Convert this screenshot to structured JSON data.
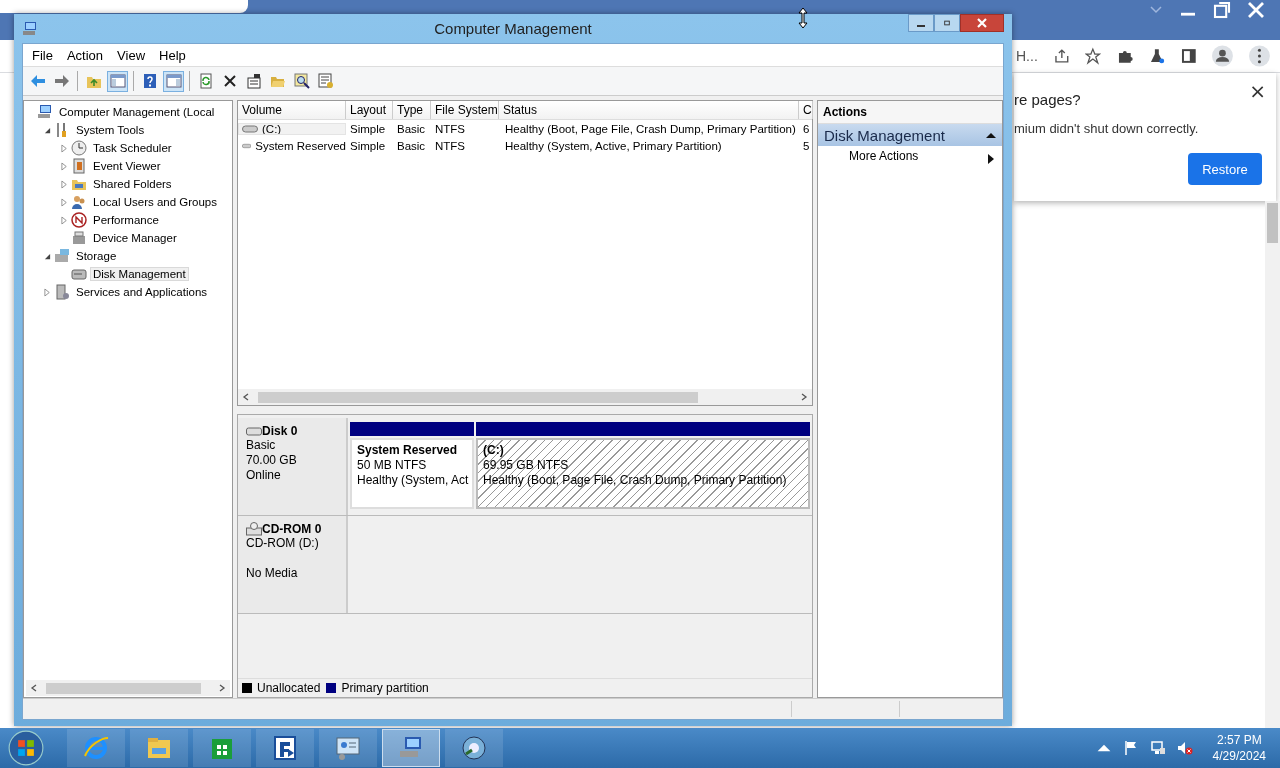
{
  "browser": {
    "address": "H...",
    "restore_dialog": {
      "title": "re pages?",
      "message": "mium didn't shut down correctly.",
      "button": "Restore",
      "close": "×"
    }
  },
  "window": {
    "title": "Computer Management"
  },
  "menu": [
    "File",
    "Action",
    "View",
    "Help"
  ],
  "toolbar": [
    {
      "kind": "back",
      "on": false
    },
    {
      "kind": "forward",
      "on": false
    },
    {
      "kind": "sep"
    },
    {
      "kind": "up",
      "on": false
    },
    {
      "kind": "tree",
      "on": true
    },
    {
      "kind": "sep"
    },
    {
      "kind": "help",
      "on": false
    },
    {
      "kind": "pane",
      "on": true
    },
    {
      "kind": "sep"
    },
    {
      "kind": "refresh",
      "on": false
    },
    {
      "kind": "delete",
      "on": false
    },
    {
      "kind": "properties",
      "on": false
    },
    {
      "kind": "open",
      "on": false
    },
    {
      "kind": "find",
      "on": false
    },
    {
      "kind": "settings",
      "on": false
    }
  ],
  "tree": [
    {
      "label": "Computer Management (Local",
      "kind": "computer",
      "selected": false,
      "children": [
        {
          "label": "System Tools",
          "kind": "tools",
          "expanded": true,
          "selected": false,
          "children": [
            {
              "label": "Task Scheduler",
              "kind": "clock",
              "expanded": false,
              "selected": false
            },
            {
              "label": "Event Viewer",
              "kind": "log",
              "expanded": false,
              "selected": false
            },
            {
              "label": "Shared Folders",
              "kind": "share",
              "expanded": false,
              "selected": false
            },
            {
              "label": "Local Users and Groups",
              "kind": "users",
              "expanded": false,
              "selected": false
            },
            {
              "label": "Performance",
              "kind": "gauge",
              "expanded": false,
              "selected": false
            },
            {
              "label": "Device Manager",
              "kind": "device",
              "selected": false
            }
          ]
        },
        {
          "label": "Storage",
          "kind": "storage",
          "expanded": true,
          "selected": false,
          "children": [
            {
              "label": "Disk Management",
              "kind": "disk",
              "selected": true
            }
          ]
        },
        {
          "label": "Services and Applications",
          "kind": "services",
          "expanded": false,
          "selected": false
        }
      ]
    }
  ],
  "volumes": {
    "columns": [
      "Volume",
      "Layout",
      "Type",
      "File System",
      "Status",
      "C"
    ],
    "rows": [
      {
        "selected": true,
        "cells": [
          "(C:)",
          "Simple",
          "Basic",
          "NTFS",
          "Healthy (Boot, Page File, Crash Dump, Primary Partition)",
          "6"
        ]
      },
      {
        "selected": false,
        "cells": [
          "System Reserved",
          "Simple",
          "Basic",
          "NTFS",
          "Healthy (System, Active, Primary Partition)",
          "5"
        ]
      }
    ]
  },
  "disks": [
    {
      "kind": "disk",
      "name": "Disk 0",
      "lines": [
        "Basic",
        "70.00 GB",
        "Online"
      ],
      "partitions": [
        {
          "name": "System Reserved",
          "size": "50 MB NTFS",
          "status": "Healthy (System, Act",
          "color": "#000080",
          "selected": false
        },
        {
          "name": "(C:)",
          "size": "69.95 GB NTFS",
          "status": "Healthy (Boot, Page File, Crash Dump, Primary Partition)",
          "color": "#000080",
          "selected": true
        }
      ]
    },
    {
      "kind": "cdrom",
      "name": "CD-ROM 0",
      "lines": [
        "CD-ROM (D:)",
        "No Media"
      ]
    }
  ],
  "legend": [
    {
      "label": "Unallocated",
      "color": "#000000"
    },
    {
      "label": "Primary partition",
      "color": "#000080"
    }
  ],
  "actions": {
    "title": "Actions",
    "section": "Disk Management",
    "items": [
      "More Actions"
    ]
  },
  "taskbar": {
    "items": [
      {
        "kind": "ie",
        "selected": false
      },
      {
        "kind": "explorer",
        "selected": false
      },
      {
        "kind": "store",
        "selected": false
      },
      {
        "kind": "app",
        "selected": false
      },
      {
        "kind": "panel",
        "selected": false
      },
      {
        "kind": "mgmt",
        "selected": true
      },
      {
        "kind": "globe",
        "selected": false
      }
    ],
    "time": "2:57 PM",
    "date": "4/29/2024"
  }
}
